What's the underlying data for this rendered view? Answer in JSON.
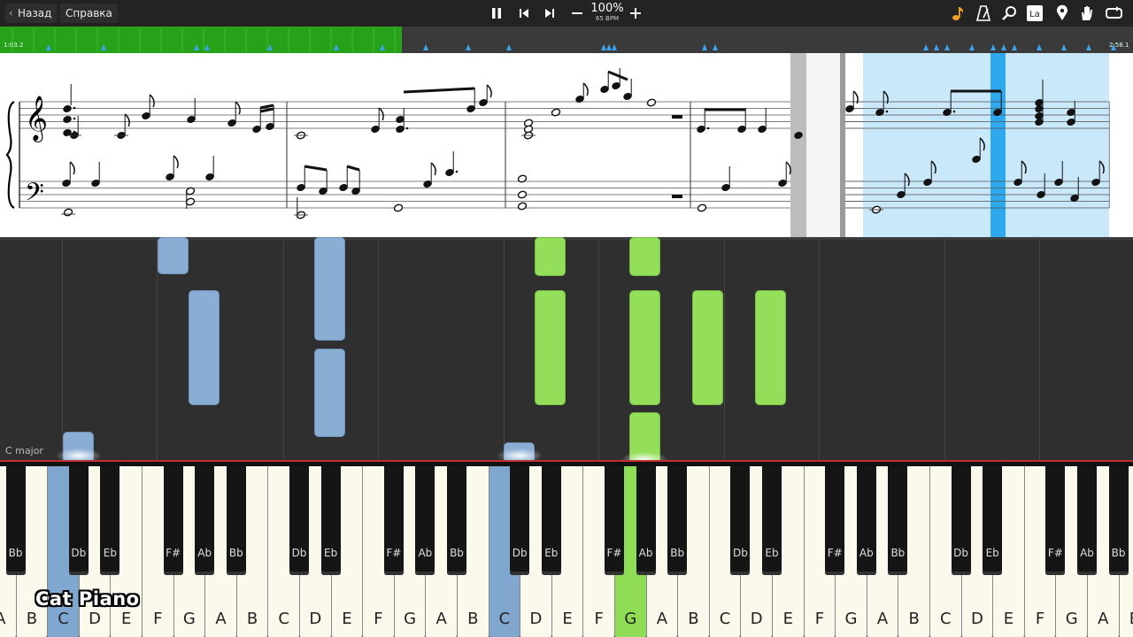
{
  "toolbar": {
    "back_label": "Назад",
    "help_label": "Справка",
    "zoom_percent": "100%",
    "bpm": "65 BPM",
    "icons": [
      "pause-icon",
      "skip-back-icon",
      "skip-forward-icon",
      "minus-icon",
      "plus-icon",
      "music-note-icon",
      "metronome-icon",
      "magnifier-icon",
      "label-icon",
      "location-pin-icon",
      "hand-icon",
      "loop-icon"
    ],
    "label_icon_text": "La",
    "accent_color": "#f0a020"
  },
  "timeline": {
    "elapsed": "1:03.2",
    "total": "2:58.1",
    "progress_fraction": 0.355,
    "done_color": "#27a01a"
  },
  "waterfall": {
    "key_signature_label": "C major"
  },
  "keyboard": {
    "white_keys": [
      "A",
      "B",
      "C",
      "D",
      "E",
      "F",
      "G",
      "A",
      "B",
      "C",
      "D",
      "E",
      "F",
      "G",
      "A",
      "B",
      "C",
      "D",
      "E",
      "F",
      "G",
      "A",
      "B",
      "C",
      "D",
      "E",
      "F",
      "G",
      "A",
      "B",
      "C",
      "D",
      "E",
      "F",
      "G",
      "A",
      "B"
    ],
    "black_keys": [
      "Bb",
      "Db",
      "Eb",
      "F#",
      "Ab",
      "Bb",
      "Db",
      "Eb",
      "F#",
      "Ab",
      "Bb",
      "Db",
      "Eb",
      "F#",
      "Ab",
      "Bb",
      "Db",
      "Eb",
      "F#",
      "Ab",
      "Bb",
      "Db",
      "Eb",
      "F#",
      "Ab",
      "Bb"
    ],
    "active_left_hand_color": "#7fa7d0",
    "active_right_hand_color": "#8fdc55"
  },
  "watermark": "Cat Piano"
}
